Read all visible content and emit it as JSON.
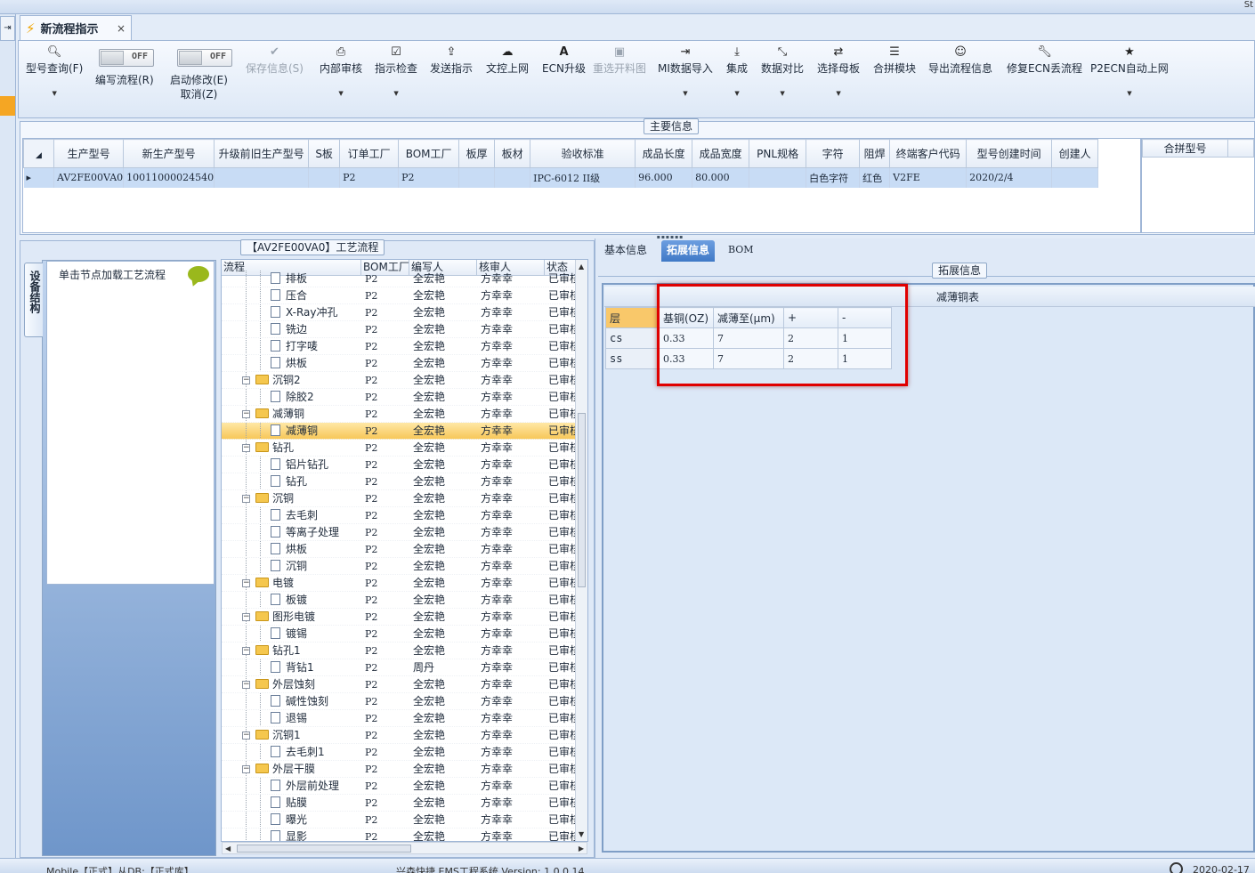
{
  "window": {
    "corner_text": "St"
  },
  "left_rail": {
    "button_glyph": "⇥"
  },
  "document_tab": {
    "title": "新流程指示",
    "close": "×"
  },
  "ribbon": {
    "query_label": "型号查询(F)",
    "write_label": "编写流程(R)",
    "modify_label": "启动修改(E)",
    "cancel_label": "取消(Z)",
    "toggle_off": "OFF",
    "buttons": [
      {
        "label": "保存信息(S)",
        "disabled": true
      },
      {
        "label": "内部审核"
      },
      {
        "label": "指示检查"
      },
      {
        "label": "发送指示"
      },
      {
        "label": "文控上网"
      },
      {
        "label": "ECN升级"
      },
      {
        "label": "重选开料图",
        "disabled": true
      },
      {
        "label": "MI数据导入"
      },
      {
        "label": "集成"
      },
      {
        "label": "数据对比"
      },
      {
        "label": "选择母板"
      },
      {
        "label": "合拼模块"
      },
      {
        "label": "导出流程信息"
      },
      {
        "label": "修复ECN丢流程"
      },
      {
        "label": "P2ECN自动上网"
      }
    ]
  },
  "main_info": {
    "caption": "主要信息",
    "columns": [
      "生产型号",
      "新生产型号",
      "升级前旧生产型号",
      "S板",
      "订单工厂",
      "BOM工厂",
      "板厚",
      "板材",
      "验收标准",
      "成品长度",
      "成品宽度",
      "PNL规格",
      "字符",
      "阻焊",
      "终端客户代码",
      "型号创建时间",
      "创建人"
    ],
    "row": [
      "AV2FE00VA0",
      "10011000024540",
      "",
      "",
      "P2",
      "P2",
      "",
      "",
      "IPC-6012 II级",
      "96.000",
      "80.000",
      "",
      "白色字符",
      "红色",
      "V2FE",
      "2020/2/4",
      ""
    ],
    "merge_column": "合拼型号"
  },
  "process": {
    "caption": "【AV2FE00VA0】工艺流程",
    "side_tab": "设备结构",
    "tool_hint": "单击节点加载工艺流程",
    "columns": [
      "流程",
      "BOM工厂",
      "编写人",
      "核审人",
      "状态"
    ],
    "rows": [
      {
        "name": "排板",
        "level": 2,
        "bom": "P2",
        "writer": "全宏艳",
        "reviewer": "方幸幸",
        "status": "已审核"
      },
      {
        "name": "压合",
        "level": 2,
        "bom": "P2",
        "writer": "全宏艳",
        "reviewer": "方幸幸",
        "status": "已审核"
      },
      {
        "name": "X-Ray冲孔",
        "level": 2,
        "bom": "P2",
        "writer": "全宏艳",
        "reviewer": "方幸幸",
        "status": "已审核"
      },
      {
        "name": "铣边",
        "level": 2,
        "bom": "P2",
        "writer": "全宏艳",
        "reviewer": "方幸幸",
        "status": "已审核"
      },
      {
        "name": "打字唛",
        "level": 2,
        "bom": "P2",
        "writer": "全宏艳",
        "reviewer": "方幸幸",
        "status": "已审核"
      },
      {
        "name": "烘板",
        "level": 2,
        "bom": "P2",
        "writer": "全宏艳",
        "reviewer": "方幸幸",
        "status": "已审核"
      },
      {
        "name": "沉铜2",
        "level": 1,
        "bom": "P2",
        "writer": "全宏艳",
        "reviewer": "方幸幸",
        "status": "已审核"
      },
      {
        "name": "除胶2",
        "level": 2,
        "bom": "P2",
        "writer": "全宏艳",
        "reviewer": "方幸幸",
        "status": "已审核"
      },
      {
        "name": "减薄铜",
        "level": 1,
        "bom": "P2",
        "writer": "全宏艳",
        "reviewer": "方幸幸",
        "status": "已审核"
      },
      {
        "name": "减薄铜",
        "level": 2,
        "bom": "P2",
        "writer": "全宏艳",
        "reviewer": "方幸幸",
        "status": "已审核",
        "selected": true
      },
      {
        "name": "钻孔",
        "level": 1,
        "bom": "P2",
        "writer": "全宏艳",
        "reviewer": "方幸幸",
        "status": "已审核"
      },
      {
        "name": "铝片钻孔",
        "level": 2,
        "bom": "P2",
        "writer": "全宏艳",
        "reviewer": "方幸幸",
        "status": "已审核"
      },
      {
        "name": "钻孔",
        "level": 2,
        "bom": "P2",
        "writer": "全宏艳",
        "reviewer": "方幸幸",
        "status": "已审核"
      },
      {
        "name": "沉铜",
        "level": 1,
        "bom": "P2",
        "writer": "全宏艳",
        "reviewer": "方幸幸",
        "status": "已审核"
      },
      {
        "name": "去毛刺",
        "level": 2,
        "bom": "P2",
        "writer": "全宏艳",
        "reviewer": "方幸幸",
        "status": "已审核"
      },
      {
        "name": "等离子处理",
        "level": 2,
        "bom": "P2",
        "writer": "全宏艳",
        "reviewer": "方幸幸",
        "status": "已审核"
      },
      {
        "name": "烘板",
        "level": 2,
        "bom": "P2",
        "writer": "全宏艳",
        "reviewer": "方幸幸",
        "status": "已审核"
      },
      {
        "name": "沉铜",
        "level": 2,
        "bom": "P2",
        "writer": "全宏艳",
        "reviewer": "方幸幸",
        "status": "已审核"
      },
      {
        "name": "电镀",
        "level": 1,
        "bom": "P2",
        "writer": "全宏艳",
        "reviewer": "方幸幸",
        "status": "已审核"
      },
      {
        "name": "板镀",
        "level": 2,
        "bom": "P2",
        "writer": "全宏艳",
        "reviewer": "方幸幸",
        "status": "已审核"
      },
      {
        "name": "图形电镀",
        "level": 1,
        "bom": "P2",
        "writer": "全宏艳",
        "reviewer": "方幸幸",
        "status": "已审核"
      },
      {
        "name": "镀锡",
        "level": 2,
        "bom": "P2",
        "writer": "全宏艳",
        "reviewer": "方幸幸",
        "status": "已审核"
      },
      {
        "name": "钻孔1",
        "level": 1,
        "bom": "P2",
        "writer": "全宏艳",
        "reviewer": "方幸幸",
        "status": "已审核"
      },
      {
        "name": "背钻1",
        "level": 2,
        "bom": "P2",
        "writer": "周丹",
        "reviewer": "方幸幸",
        "status": "已审核"
      },
      {
        "name": "外层蚀刻",
        "level": 1,
        "bom": "P2",
        "writer": "全宏艳",
        "reviewer": "方幸幸",
        "status": "已审核"
      },
      {
        "name": "碱性蚀刻",
        "level": 2,
        "bom": "P2",
        "writer": "全宏艳",
        "reviewer": "方幸幸",
        "status": "已审核"
      },
      {
        "name": "退锡",
        "level": 2,
        "bom": "P2",
        "writer": "全宏艳",
        "reviewer": "方幸幸",
        "status": "已审核"
      },
      {
        "name": "沉铜1",
        "level": 1,
        "bom": "P2",
        "writer": "全宏艳",
        "reviewer": "方幸幸",
        "status": "已审核"
      },
      {
        "name": "去毛刺1",
        "level": 2,
        "bom": "P2",
        "writer": "全宏艳",
        "reviewer": "方幸幸",
        "status": "已审核"
      },
      {
        "name": "外层干膜",
        "level": 1,
        "bom": "P2",
        "writer": "全宏艳",
        "reviewer": "方幸幸",
        "status": "已审核"
      },
      {
        "name": "外层前处理",
        "level": 2,
        "bom": "P2",
        "writer": "全宏艳",
        "reviewer": "方幸幸",
        "status": "已审核"
      },
      {
        "name": "贴膜",
        "level": 2,
        "bom": "P2",
        "writer": "全宏艳",
        "reviewer": "方幸幸",
        "status": "已审核"
      },
      {
        "name": "曝光",
        "level": 2,
        "bom": "P2",
        "writer": "全宏艳",
        "reviewer": "方幸幸",
        "status": "已审核"
      },
      {
        "name": "显影",
        "level": 2,
        "bom": "P2",
        "writer": "全宏艳",
        "reviewer": "方幸幸",
        "status": "已审核"
      }
    ]
  },
  "right": {
    "tabs": [
      {
        "label": "基本信息"
      },
      {
        "label": "拓展信息",
        "active": true
      },
      {
        "label": "BOM"
      }
    ],
    "ext_caption": "拓展信息",
    "table_title": "减薄铜表",
    "table_headers": [
      "层",
      "基铜(OZ)",
      "减薄至(μm)",
      "+",
      "-"
    ],
    "table_rows": [
      [
        "cs",
        "0.33",
        "7",
        "2",
        "1"
      ],
      [
        "ss",
        "0.33",
        "7",
        "2",
        "1"
      ]
    ]
  },
  "status_bar": {
    "left": "Mobile【正式】从DB:【正式库】",
    "center": "兴森快捷 EMS工程系统 Version: 1.0.0.14",
    "right": "2020-02-17"
  }
}
